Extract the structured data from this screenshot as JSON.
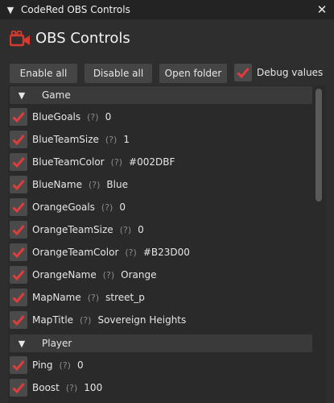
{
  "window": {
    "title": "CodeRed OBS Controls",
    "collapse_icon": "triangle-down-icon",
    "close_icon": "close-icon"
  },
  "header": {
    "title": "OBS Controls",
    "icon": "video-camera-icon",
    "icon_color": "#d63a2f"
  },
  "buttons": {
    "enable_all": "Enable all",
    "disable_all": "Disable all",
    "open_folder": "Open folder"
  },
  "debug": {
    "label": "Debug values",
    "checked": true
  },
  "colors": {
    "check": "#e23b3b",
    "background": "#2e2e2e"
  },
  "sections": [
    {
      "name": "Game",
      "rows": [
        {
          "label": "BlueGoals",
          "help": "(?)",
          "value": "0"
        },
        {
          "label": "BlueTeamSize",
          "help": "(?)",
          "value": "1"
        },
        {
          "label": "BlueTeamColor",
          "help": "(?)",
          "value": "#002DBF"
        },
        {
          "label": "BlueName",
          "help": "(?)",
          "value": "Blue"
        },
        {
          "label": "OrangeGoals",
          "help": "(?)",
          "value": "0"
        },
        {
          "label": "OrangeTeamSize",
          "help": "(?)",
          "value": "0"
        },
        {
          "label": "OrangeTeamColor",
          "help": "(?)",
          "value": "#B23D00"
        },
        {
          "label": "OrangeName",
          "help": "(?)",
          "value": "Orange"
        },
        {
          "label": "MapName",
          "help": "(?)",
          "value": "street_p"
        },
        {
          "label": "MapTitle",
          "help": "(?)",
          "value": "Sovereign Heights"
        }
      ]
    },
    {
      "name": "Player",
      "rows": [
        {
          "label": "Ping",
          "help": "(?)",
          "value": "0"
        },
        {
          "label": "Boost",
          "help": "(?)",
          "value": "100"
        }
      ]
    }
  ]
}
